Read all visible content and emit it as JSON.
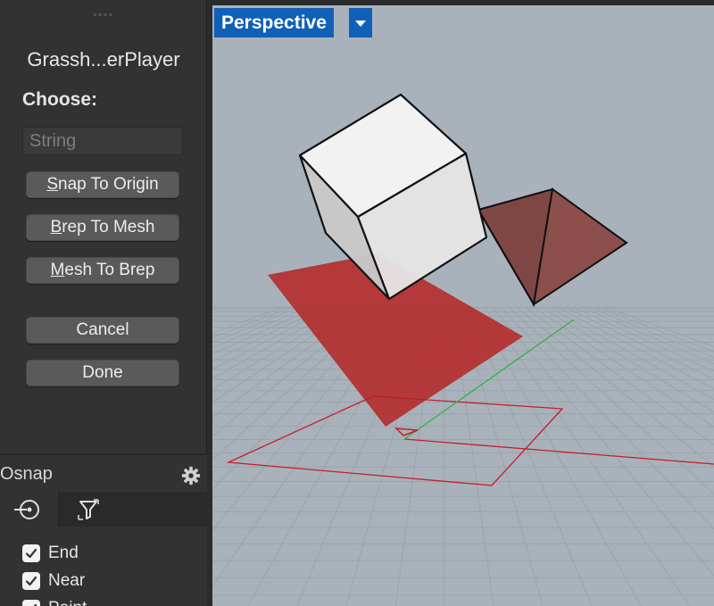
{
  "panel": {
    "drag_handle": "◦◦◦◦",
    "title": "Grassh...erPlayer",
    "choose_label": "Choose:",
    "input_placeholder": "String",
    "buttons": {
      "snap_first": "S",
      "snap_rest": "nap To Origin",
      "brep_first": "B",
      "brep_rest": "rep To Mesh",
      "mesh_first": "M",
      "mesh_rest": "esh To Brep",
      "cancel": "Cancel",
      "done": "Done"
    }
  },
  "osnap": {
    "title": "Osnap",
    "items": [
      {
        "label": "End",
        "checked": true
      },
      {
        "label": "Near",
        "checked": true
      },
      {
        "label": "Point",
        "checked": true
      }
    ]
  },
  "viewport": {
    "title": "Perspective",
    "accent_color": "#1060b8",
    "background_color": "#a9b2bb",
    "grid_color": "#9aa3ac",
    "surface_color": "#b51f1f"
  }
}
